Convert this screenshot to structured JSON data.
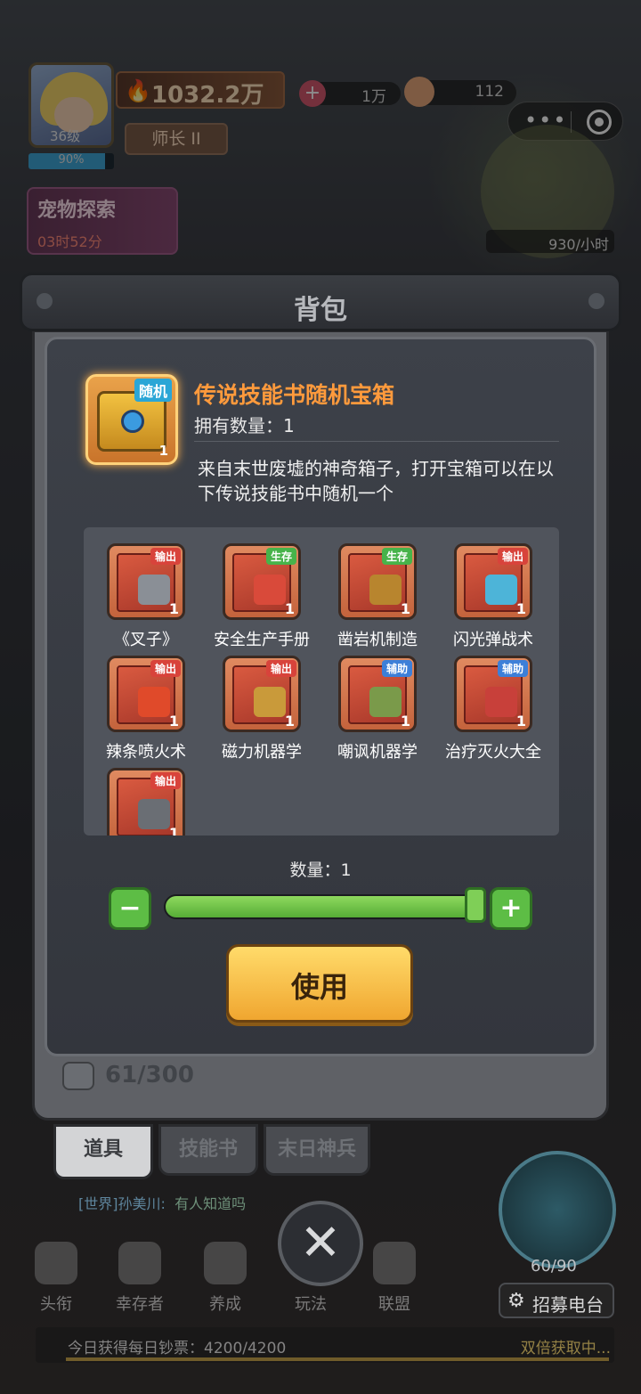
{
  "hud": {
    "level": "36级",
    "exp_percent": "90%",
    "exp_fraction": 0.9,
    "power": "1032.2万",
    "rank": "师长 II",
    "resource1": "1万",
    "resource2": "112",
    "menu_dots": "•••",
    "pet_explore": {
      "title": "宠物探索",
      "time": "03时52分"
    },
    "production_rate": "930/小时"
  },
  "bag": {
    "title": "背包",
    "item": {
      "tag": "随机",
      "count": "1",
      "name": "传说技能书随机宝箱",
      "owned": "拥有数量：1",
      "description": "来自末世废墟的神奇箱子，打开宝箱可以在以下传说技能书中随机一个"
    },
    "books": [
      {
        "tag": "输出",
        "tag_type": "out",
        "label": "《叉子》",
        "count": "1",
        "color": "#8a8f96"
      },
      {
        "tag": "生存",
        "tag_type": "live",
        "label": "安全生产手册",
        "count": "1",
        "color": "#d94a3a"
      },
      {
        "tag": "生存",
        "tag_type": "live",
        "label": "凿岩机制造",
        "count": "1",
        "color": "#b8852e"
      },
      {
        "tag": "输出",
        "tag_type": "out",
        "label": "闪光弹战术",
        "count": "1",
        "color": "#4db4d8"
      },
      {
        "tag": "输出",
        "tag_type": "out",
        "label": "辣条喷火术",
        "count": "1",
        "color": "#e04a2a"
      },
      {
        "tag": "输出",
        "tag_type": "out",
        "label": "磁力机器学",
        "count": "1",
        "color": "#c99a3a"
      },
      {
        "tag": "辅助",
        "tag_type": "help",
        "label": "嘲讽机器学",
        "count": "1",
        "color": "#7a9a4a"
      },
      {
        "tag": "辅助",
        "tag_type": "help",
        "label": "治疗灭火大全",
        "count": "1",
        "color": "#c8403a"
      },
      {
        "tag": "输出",
        "tag_type": "out",
        "label": "",
        "count": "1",
        "color": "#6a6e74"
      }
    ],
    "quantity_label": "数量：1",
    "quantity_fraction": 1.0,
    "minus": "−",
    "plus": "+",
    "use_label": "使用",
    "capacity": "61/300",
    "tabs": [
      "道具",
      "技能书",
      "末日神兵"
    ],
    "active_tab": 0
  },
  "chat": {
    "channel": "[世界]",
    "name": "孙美川:",
    "message": "有人知道吗"
  },
  "nav": {
    "items": [
      "头衔",
      "幸存者",
      "养成",
      "玩法",
      "联盟"
    ],
    "close": "✕"
  },
  "radar": {
    "count": "60/90",
    "recruit": "招募电台"
  },
  "ticker": {
    "left": "今日获得每日钞票：4200/4200",
    "right": "双倍获取中..."
  }
}
